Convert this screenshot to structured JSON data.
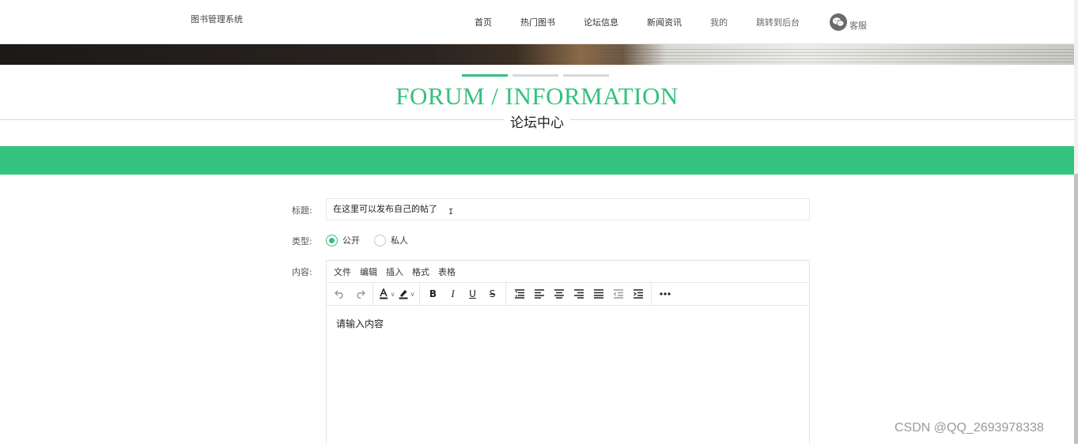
{
  "header": {
    "brand": "图书管理系统",
    "nav": [
      {
        "label": "首页"
      },
      {
        "label": "热门图书"
      },
      {
        "label": "论坛信息"
      },
      {
        "label": "新闻资讯"
      },
      {
        "label": "我的"
      },
      {
        "label": "跳转到后台"
      }
    ],
    "kefu_label": "客服",
    "kefu_icon": "wechat-icon"
  },
  "section": {
    "title_en": "FORUM / INFORMATION",
    "title_cn": "论坛中心"
  },
  "form": {
    "title_label": "标题:",
    "title_value": "在这里可以发布自己的帖了",
    "type_label": "类型:",
    "type_options": [
      {
        "label": "公开",
        "checked": true
      },
      {
        "label": "私人",
        "checked": false
      }
    ],
    "content_label": "内容:"
  },
  "editor": {
    "menu": [
      "文件",
      "编辑",
      "插入",
      "格式",
      "表格"
    ],
    "content": "请输入内容",
    "toolbar_icons": [
      "undo-icon",
      "redo-icon",
      "text-color-icon",
      "highlight-icon",
      "bold-icon",
      "italic-icon",
      "underline-icon",
      "strikethrough-icon",
      "line-height-icon",
      "align-left-icon",
      "align-center-icon",
      "align-right-icon",
      "align-justify-icon",
      "outdent-icon",
      "indent-icon",
      "more-icon"
    ]
  },
  "colors": {
    "accent": "#34c17f",
    "band": "#34c47f"
  },
  "watermark": "CSDN @QQ_2693978338"
}
